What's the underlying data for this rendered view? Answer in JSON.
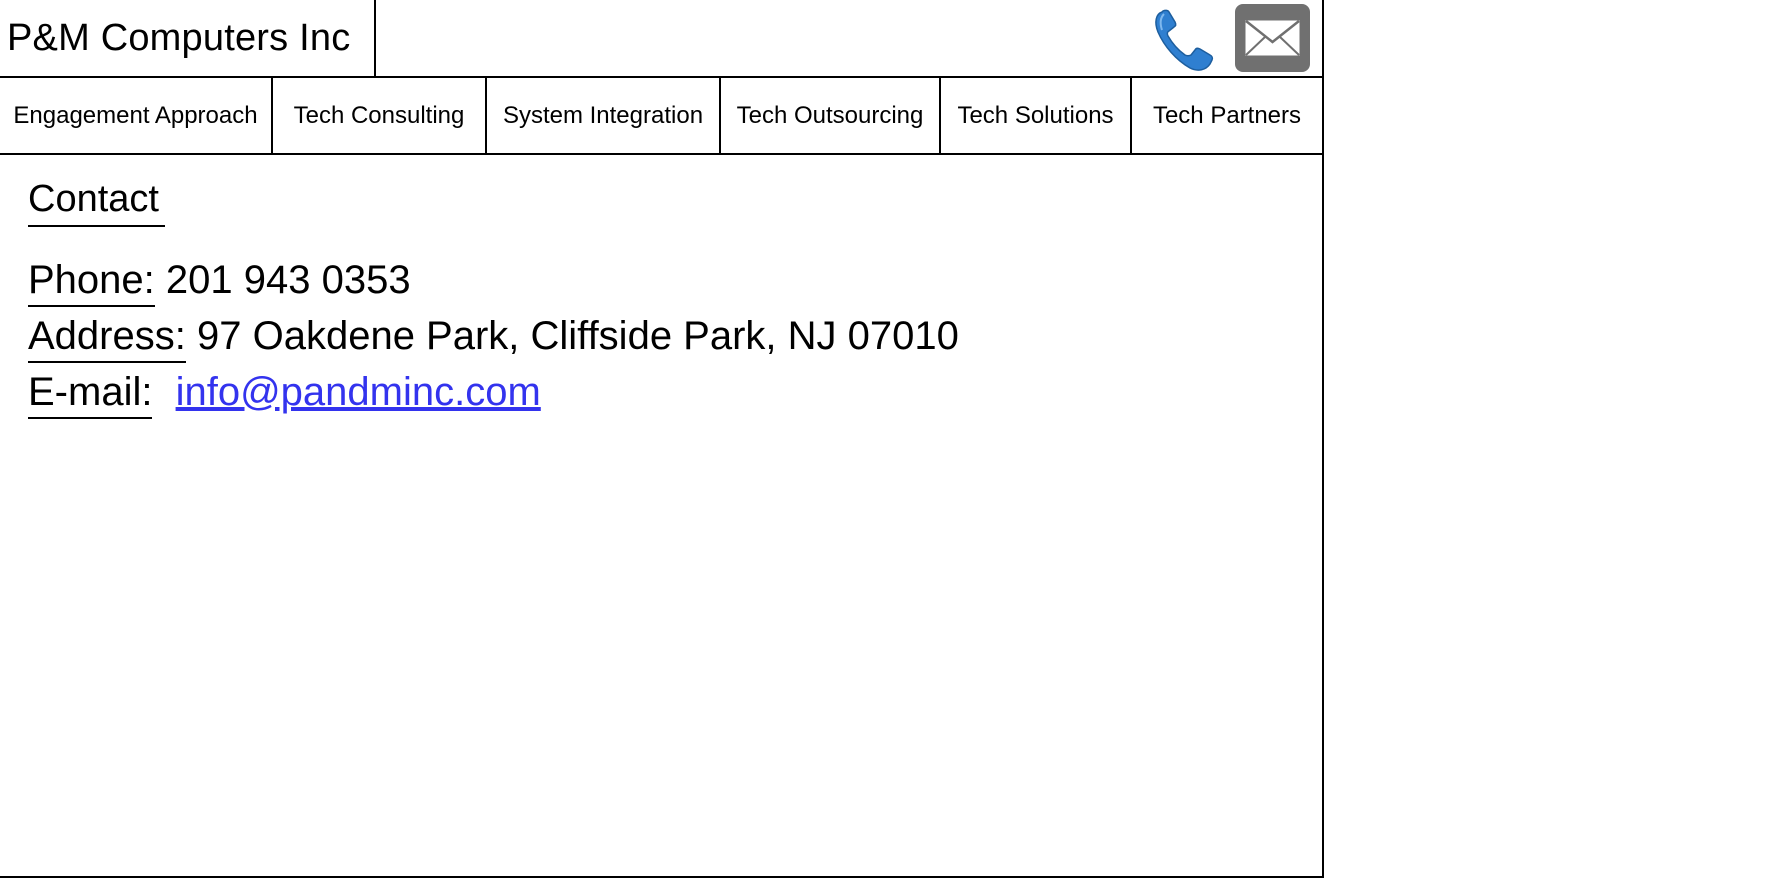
{
  "header": {
    "company_name": "P&M Computers Inc",
    "phone_icon": "phone-icon",
    "mail_icon": "mail-icon",
    "phone_icon_color": "#2f7fd0",
    "mail_icon_bg": "#707070"
  },
  "nav": {
    "items": [
      {
        "label": "Engagement Approach"
      },
      {
        "label": "Tech Consulting"
      },
      {
        "label": "System Integration"
      },
      {
        "label": "Tech Outsourcing"
      },
      {
        "label": "Tech Solutions"
      },
      {
        "label": "Tech Partners"
      }
    ]
  },
  "contact": {
    "heading": "Contact",
    "phone_label": "Phone:",
    "phone_value": "201 943 0353",
    "address_label": "Address:",
    "address_value": "97 Oakdene Park, Cliffside Park, NJ 07010",
    "email_label": "E-mail:",
    "email_value": "info@pandminc.com",
    "email_link_color": "#3333ee"
  }
}
